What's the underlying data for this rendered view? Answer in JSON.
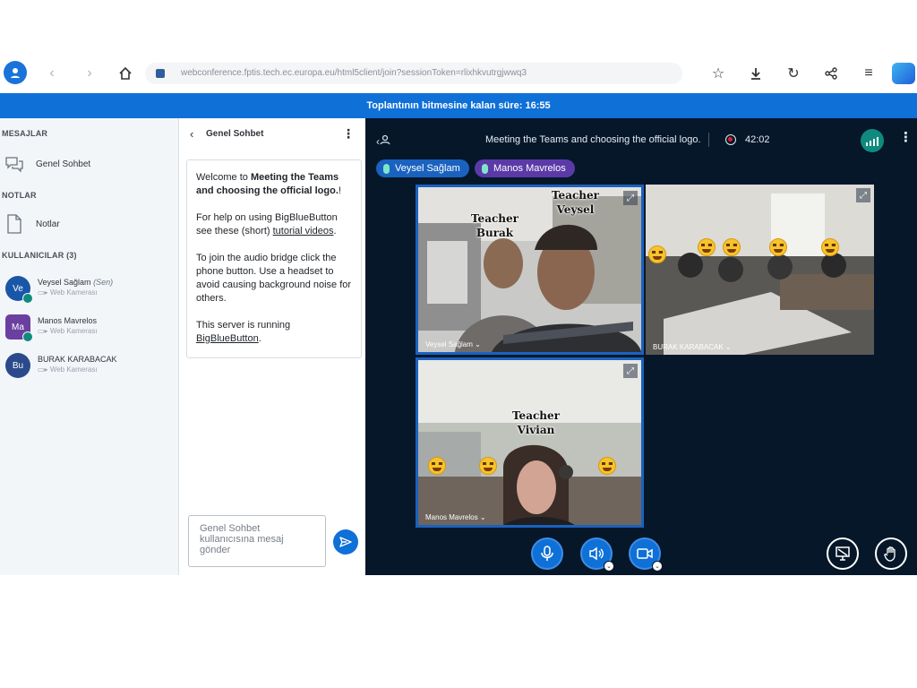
{
  "browser": {
    "url": "webconference.fptis.tech.ec.europa.eu/html5client/join?sessionToken=rlixhkvutrgjwwq3"
  },
  "banner": {
    "meeting_time_left": "Toplantının bitmesine kalan süre: 16:55"
  },
  "userlist": {
    "messages_title": "MESAJLAR",
    "public_chat_label": "Genel Sohbet",
    "notes_title": "NOTLAR",
    "notes_label": "Notlar",
    "users_title": "KULLANICILAR (3)",
    "users": [
      {
        "initials": "Ve",
        "name": "Veysel Sağlam",
        "you": "(Sen)",
        "status": "Web Kamerası",
        "color": "#1a56a8"
      },
      {
        "initials": "Ma",
        "name": "Manos Mavrelos",
        "status": "Web Kamerası",
        "color": "#6b3fa0"
      },
      {
        "initials": "Bu",
        "name": "BURAK KARABACAK",
        "status": "Web Kamerası",
        "color": "#2a4a8c"
      }
    ]
  },
  "chat": {
    "title": "Genel Sohbet",
    "welcome_intro": "Welcome to ",
    "welcome_meeting": "Meeting the Teams and choosing the official logo.",
    "welcome_end": "!",
    "help_prefix": "For help on using BigBlueButton see these (short) ",
    "help_link": "tutorial videos",
    "help_suffix": ".",
    "audio_text": "To join the audio bridge click the phone button. Use a headset to avoid causing background noise for others.",
    "server_prefix": "This server is running ",
    "server_link": "BigBlueButton",
    "server_suffix": ".",
    "input_placeholder": "Genel Sohbet kullanıcısına mesaj gönder"
  },
  "meeting": {
    "title": "Meeting the Teams and choosing the official logo.",
    "recording_time": "42:02",
    "talkers": [
      "Veysel Sağlam",
      "Manos Mavrelos"
    ],
    "talker_colors": [
      "#1a62bf",
      "#5b3aa8"
    ],
    "tiles": [
      {
        "label": "Veysel Sağlam",
        "overlays": [
          "Teacher\nBurak",
          "Teacher\nVeysel"
        ]
      },
      {
        "label": "BURAK KARABACAK"
      },
      {
        "label": "Manos Mavrelos",
        "overlays": [
          "Teacher\nVivian"
        ]
      }
    ]
  },
  "icons": {
    "connection": "signal-bars-icon",
    "mic": "microphone-icon",
    "audio": "speaker-icon",
    "camera": "video-camera-icon",
    "screen": "presentation-icon",
    "raise_hand": "hand-icon"
  }
}
